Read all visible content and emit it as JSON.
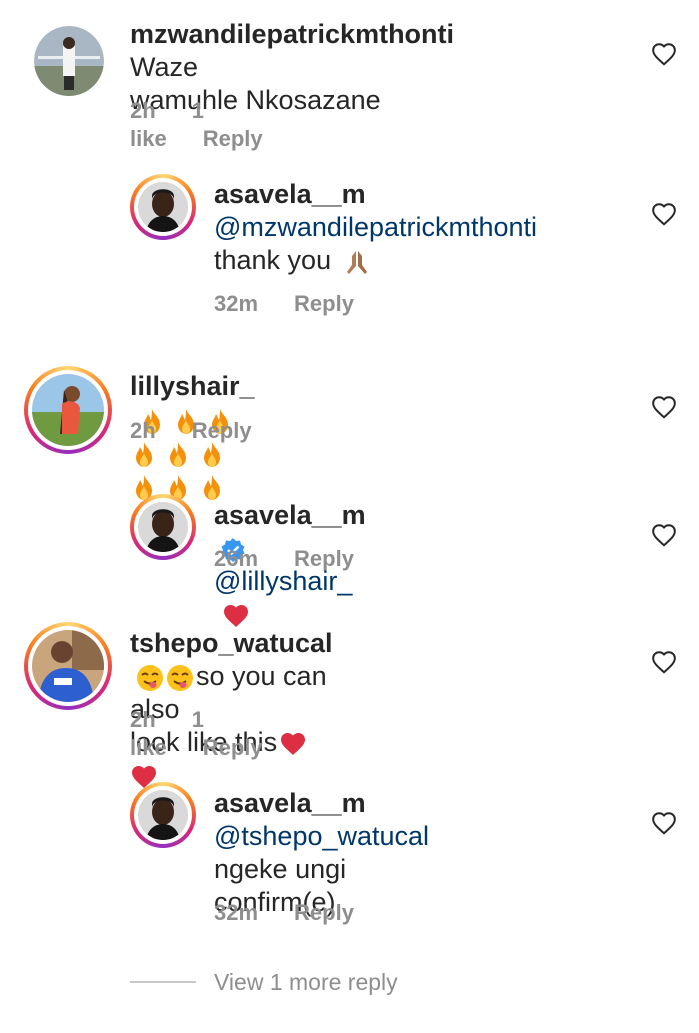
{
  "comments": [
    {
      "username": "mzwandilepatrickmthonti",
      "text_line1": " Waze",
      "text_line2": "wamuhle Nkosazane",
      "time": "2h",
      "likes": "1 like",
      "reply": "Reply"
    },
    {
      "username": "asavela__m",
      "mention": "@mzwandilepatrickmthonti",
      "text": "thank you",
      "time": "32m",
      "reply": "Reply"
    },
    {
      "username": "lillyshair_",
      "fire_count": 9,
      "time": "2h",
      "reply": "Reply"
    },
    {
      "username": "asavela__m",
      "mention": "@lillyshair_",
      "time": "26m",
      "reply": "Reply"
    },
    {
      "username": "tshepo_watucal",
      "text_line1": "so you can also",
      "text_line2": "look like this",
      "time": "2h",
      "likes": "1 like",
      "reply": "Reply"
    },
    {
      "username": "asavela__m",
      "mention": "@tshepo_watucal",
      "text_line1": " ngeke ungi",
      "text_line2": "confirm(e)",
      "time": "32m",
      "reply": "Reply"
    }
  ],
  "view_more": "View 1 more reply",
  "colors": {
    "text": "#262626",
    "muted": "#8e8e8e",
    "mention": "#00376b",
    "verified": "#3897f0",
    "heart_red": "#e0245e"
  }
}
